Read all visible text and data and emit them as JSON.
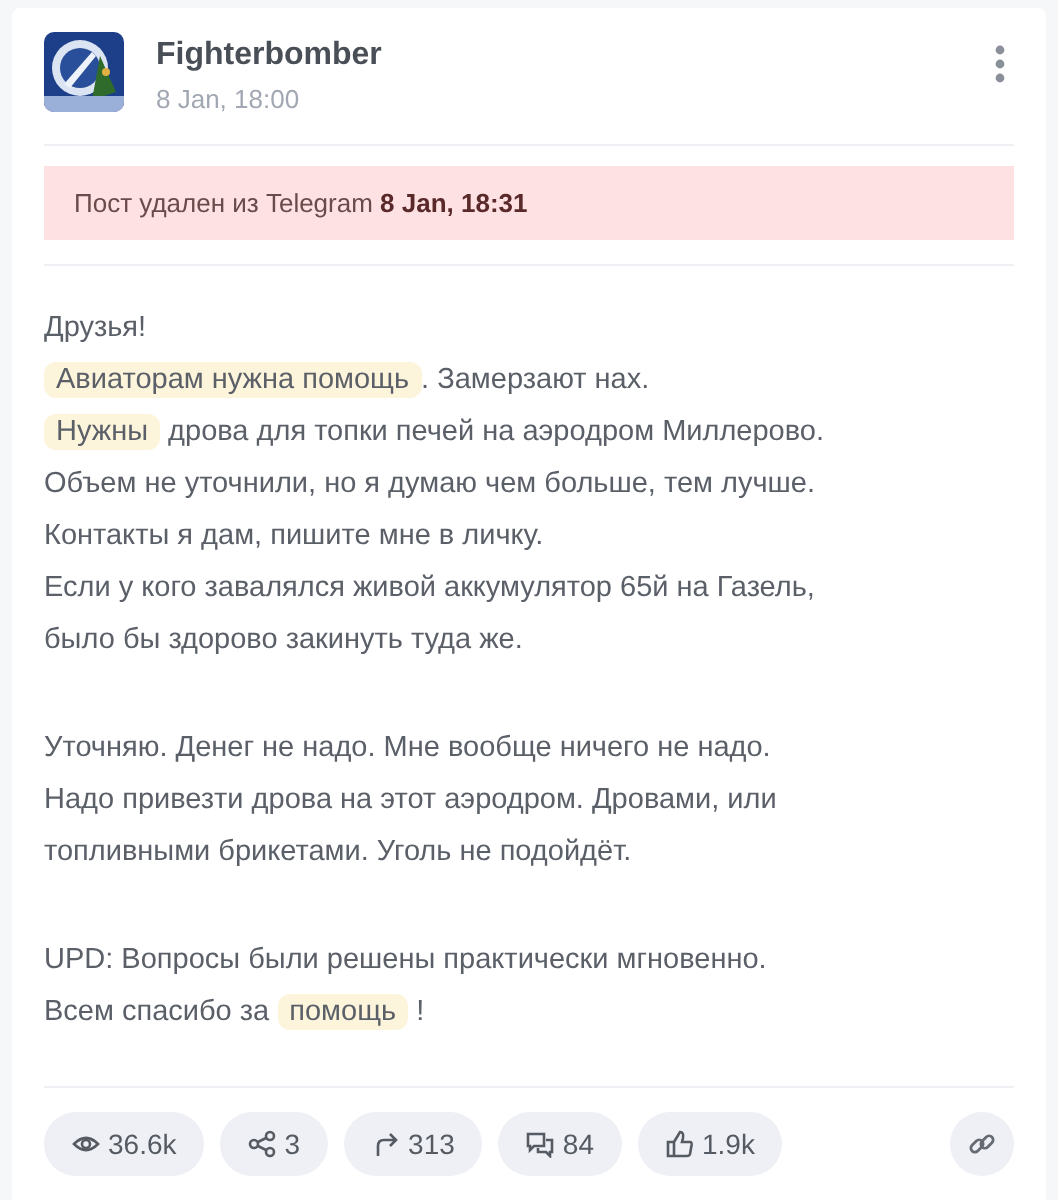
{
  "post": {
    "channel": "Fighterbomber",
    "date": "8 Jan, 18:00",
    "notice": "Пост удален из Telegram **8 Jan, 18:31**",
    "paragraphs": [
      [
        [
          {
            "text": "Друзья!",
            "highlighted": false
          }
        ],
        [
          {
            "text": "Авиаторам нужна помощь",
            "highlighted": true
          },
          {
            "text": ". Замерзают нах.",
            "highlighted": false
          }
        ],
        [
          {
            "text": "Нужны",
            "highlighted": true
          },
          {
            "text": " дрова для топки печей на аэродром Миллерово.",
            "highlighted": false
          }
        ],
        [
          {
            "text": "Объем не уточнили, но я думаю чем больше, тем лучше.",
            "highlighted": false
          }
        ],
        [
          {
            "text": "Контакты я дам, пишите мне в личку.",
            "highlighted": false
          }
        ],
        [
          {
            "text": "Если у кого завалялся живой аккумулятор 65й на Газель,",
            "highlighted": false
          }
        ],
        [
          {
            "text": "было бы здорово закинуть туда же.",
            "highlighted": false
          }
        ]
      ],
      [
        [
          {
            "text": "Уточняю. Денег не надо. Мне вообще ничего не надо.",
            "highlighted": false
          }
        ],
        [
          {
            "text": "Надо привезти дрова на этот аэродром. Дровами, или",
            "highlighted": false
          }
        ],
        [
          {
            "text": "топливными брикетами. Уголь не подойдёт.",
            "highlighted": false
          }
        ]
      ],
      [
        [
          {
            "text": "UPD: Вопросы были решены практически мгновенно.",
            "highlighted": false
          }
        ],
        [
          {
            "text": "Всем спасибо за ",
            "highlighted": false
          },
          {
            "text": "помощь",
            "highlighted": true
          },
          {
            "text": " !",
            "highlighted": false
          }
        ]
      ]
    ],
    "stats": [
      {
        "kind": "views",
        "value": "36.6k"
      },
      {
        "kind": "shares",
        "value": "3"
      },
      {
        "kind": "forwards",
        "value": "313"
      },
      {
        "kind": "comments",
        "value": "84"
      },
      {
        "kind": "reactions",
        "value": "1.9k"
      }
    ]
  }
}
